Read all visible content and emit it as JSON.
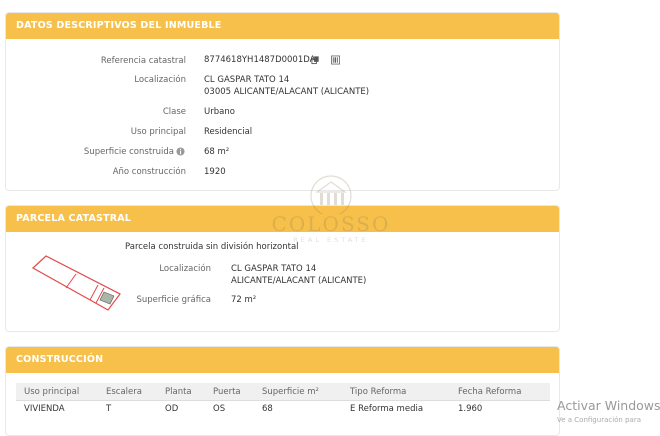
{
  "datos": {
    "title": "DATOS DESCRIPTIVOS DEL INMUEBLE",
    "rows": [
      {
        "label": "Referencia catastral",
        "value": "8774618YH1487D0001DA"
      },
      {
        "label": "Localización",
        "value": "CL GASPAR TATO 14",
        "value2": "03005 ALICANTE/ALACANT (ALICANTE)"
      },
      {
        "label": "Clase",
        "value": "Urbano"
      },
      {
        "label": "Uso principal",
        "value": "Residencial"
      },
      {
        "label": "Superficie construida",
        "value": "68 m²"
      },
      {
        "label": "Año construcción",
        "value": "1920"
      }
    ]
  },
  "parcela": {
    "title": "PARCELA CATASTRAL",
    "subtitle": "Parcela construida sin división horizontal",
    "loc_label": "Localización",
    "loc_value": "CL GASPAR TATO 14",
    "loc_value2": "ALICANTE/ALACANT (ALICANTE)",
    "sup_label": "Superficie gráfica",
    "sup_value": "72 m²"
  },
  "construccion": {
    "title": "CONSTRUCCIÓN",
    "headers": [
      "Uso principal",
      "Escalera",
      "Planta",
      "Puerta",
      "Superficie m²",
      "Tipo Reforma",
      "Fecha Reforma"
    ],
    "row": [
      "VIVIENDA",
      "T",
      "OD",
      "OS",
      "68",
      "E Reforma media",
      "1.960"
    ]
  },
  "watermark": {
    "name": "COLOSSO",
    "tagline": "REAL ESTATE"
  },
  "os_overlay": {
    "line1": "Activar Windows",
    "line2": "Ve a Configuración para"
  },
  "colors": {
    "header": "#f7c04a"
  }
}
